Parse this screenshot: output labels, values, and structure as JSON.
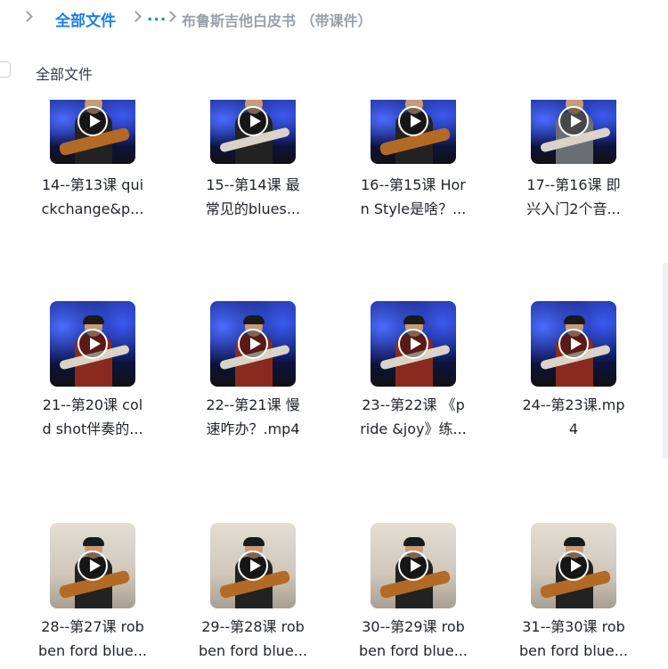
{
  "breadcrumb": {
    "root": "全部文件",
    "ellipsis": "...",
    "current": "布鲁斯吉他白皮书 （带课件）"
  },
  "select_all_label": "全部文件",
  "files": [
    {
      "line1": "14--第13课 qui",
      "line2": "ckchange&p..."
    },
    {
      "line1": "15--第14课 最",
      "line2": "常见的blues..."
    },
    {
      "line1": "16--第15课 Hor",
      "line2": "n Style是啥？..."
    },
    {
      "line1": "17--第16课 即",
      "line2": "兴入门2个音..."
    },
    {
      "line1": "21--第20课 col",
      "line2": "d shot伴奏的..."
    },
    {
      "line1": "22--第21课 慢",
      "line2": "速咋办？.mp4"
    },
    {
      "line1": "23--第22课 《p",
      "line2": "ride &joy》练..."
    },
    {
      "line1": "24--第23课.mp",
      "line2": "4"
    },
    {
      "line1": "28--第27课 rob",
      "line2": "ben ford blue..."
    },
    {
      "line1": "29--第28课 rob",
      "line2": "ben ford blue..."
    },
    {
      "line1": "30--第29课 rob",
      "line2": "ben ford blue..."
    },
    {
      "line1": "31--第30课 rob",
      "line2": "ben ford blue..."
    }
  ],
  "icons": {
    "breadcrumb_separator": "chevron-right-icon",
    "video": "play-icon"
  },
  "colors": {
    "accent": "#1c7fe6",
    "muted": "#9aa0a8",
    "text": "#1f2329"
  }
}
